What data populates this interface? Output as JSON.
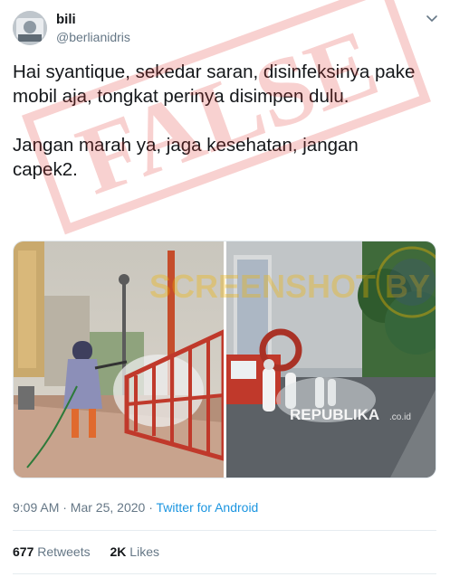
{
  "tweet": {
    "display_name": "bili",
    "handle": "@berlianidris",
    "paragraph_1": "Hai syantique, sekedar saran, disinfeksinya pake mobil aja, tongkat perinya disimpen dulu.",
    "paragraph_2": "Jangan marah ya, jaga kesehatan, jangan capek2.",
    "time": "9:09 AM · Mar 25, 2020",
    "separator": " · ",
    "source": "Twitter for Android",
    "retweets_count": "677",
    "retweets_label": "Retweets",
    "likes_count": "2K",
    "likes_label": "Likes"
  },
  "media": {
    "watermark_center": "SCREENSHOT BY",
    "photo2_caption": "REPUBLIKA",
    "photo2_caption_suffix": ".co.id"
  },
  "stamp": {
    "text": "FALSE",
    "color": "#e0332c"
  },
  "icons": {
    "chevron": "chevron-down-icon"
  }
}
